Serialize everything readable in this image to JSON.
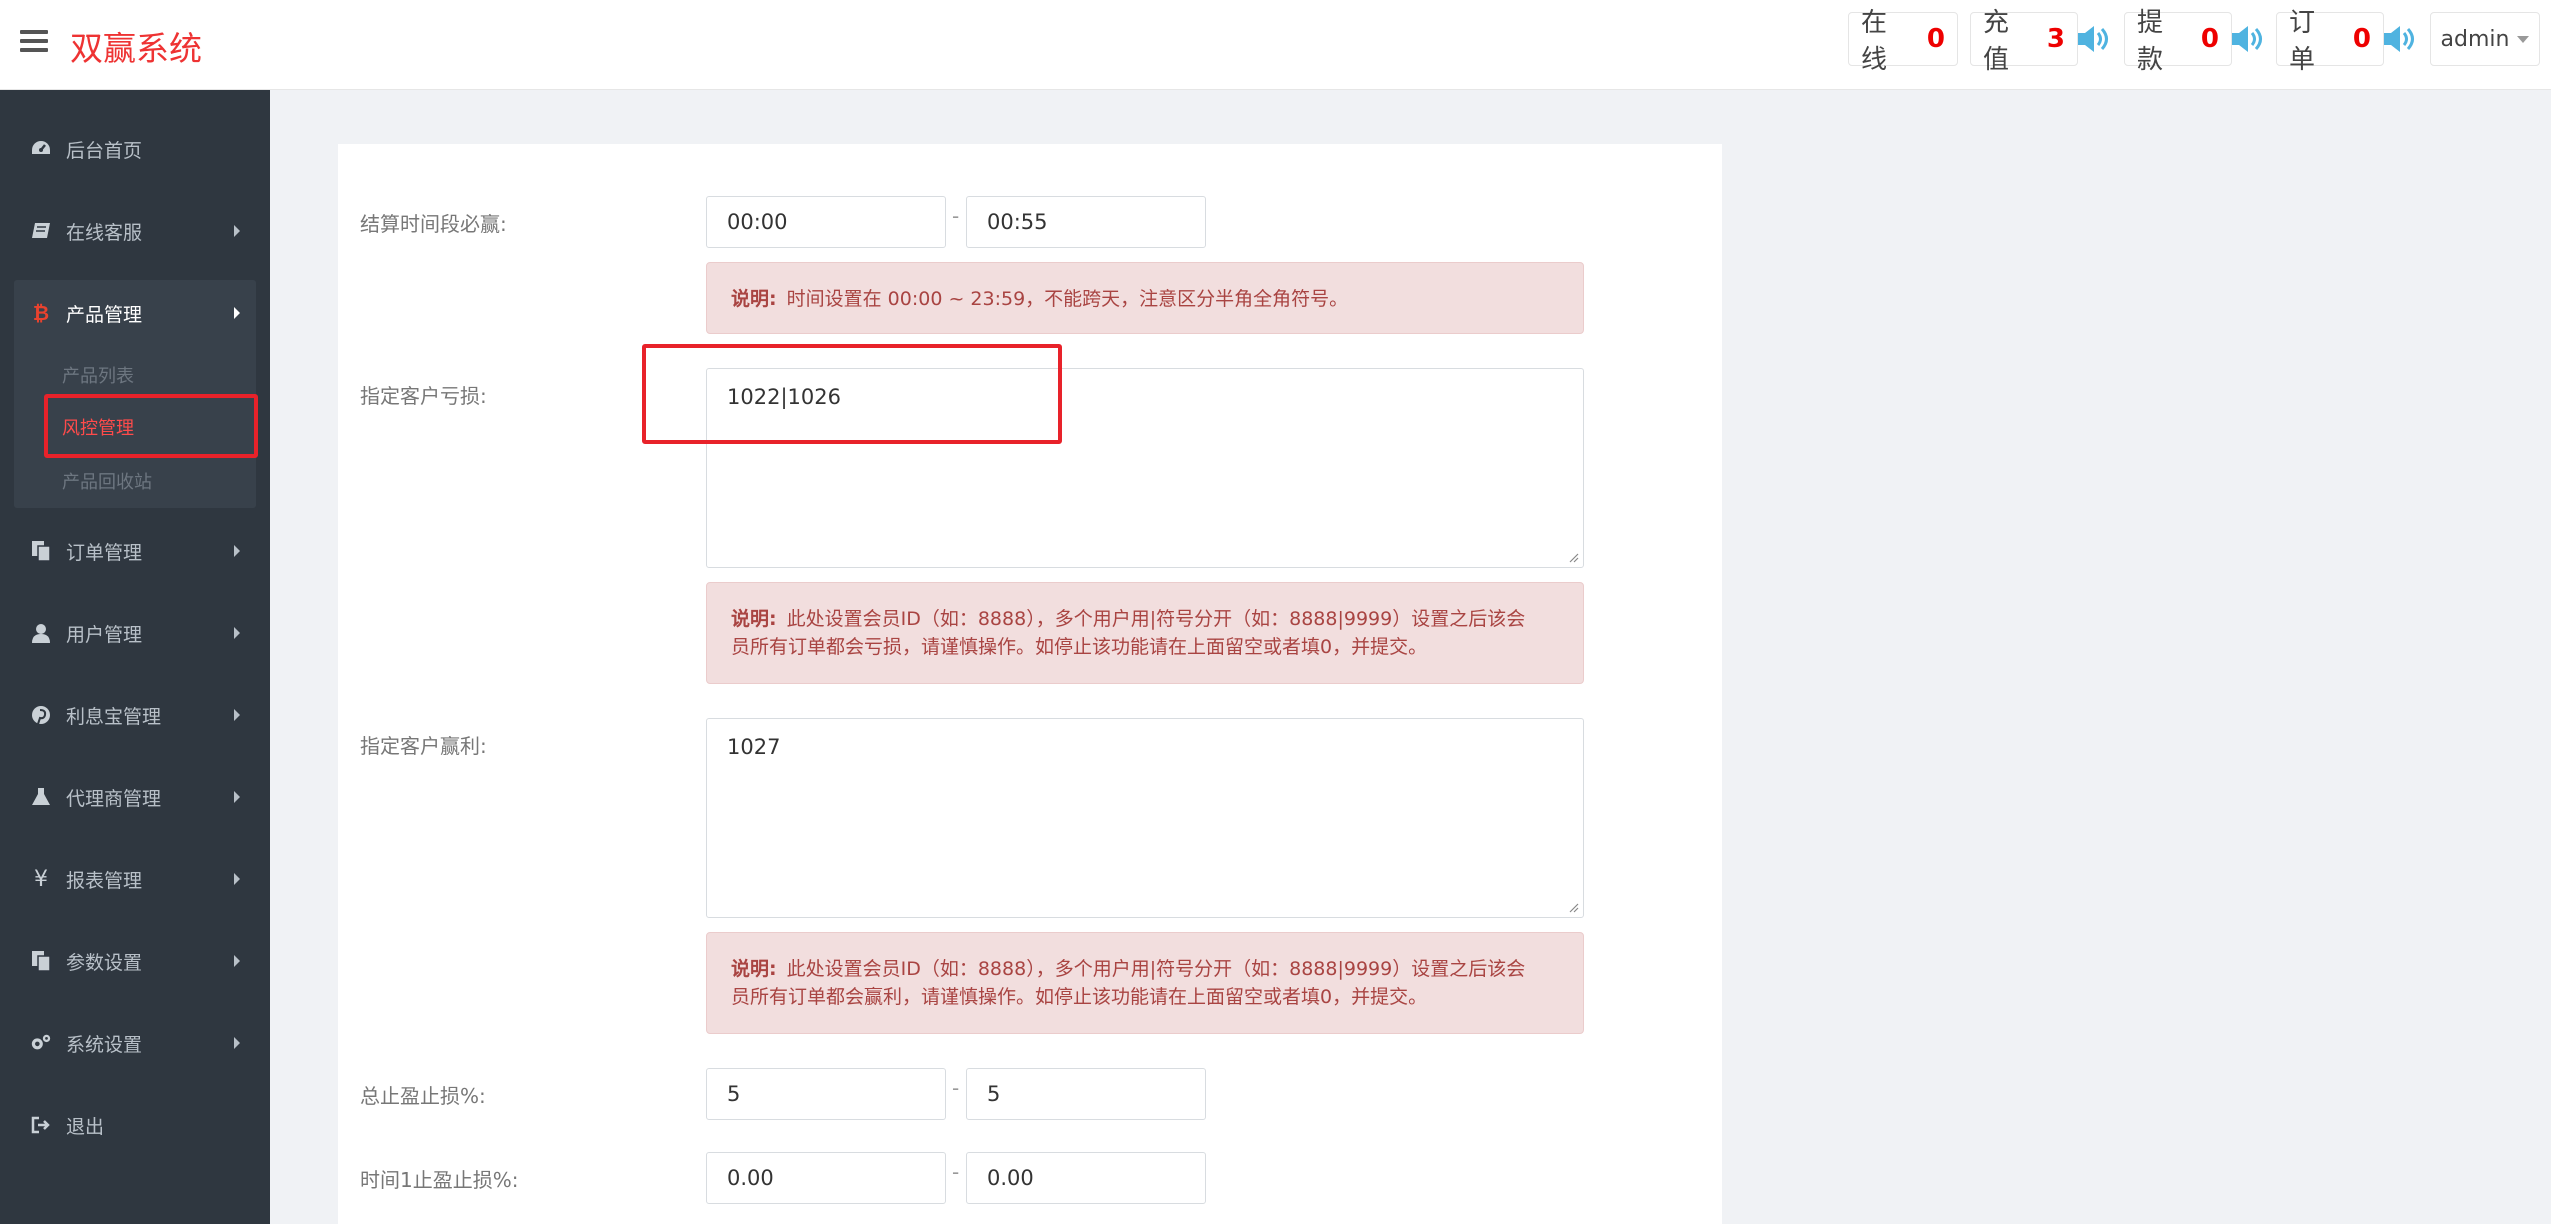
{
  "header": {
    "brand": "双赢系统",
    "stats": [
      {
        "label": "在线",
        "value": "0"
      },
      {
        "label": "充值",
        "value": "3"
      },
      {
        "label": "提款",
        "value": "0"
      },
      {
        "label": "订单",
        "value": "0"
      }
    ],
    "user": "admin",
    "speaker_color": "#4fb3e0"
  },
  "sidebar": {
    "items": [
      {
        "label": "后台首页",
        "icon": "dashboard-icon"
      },
      {
        "label": "在线客服",
        "icon": "book-icon"
      },
      {
        "label": "产品管理",
        "icon": "bitcoin-icon"
      },
      {
        "label": "订单管理",
        "icon": "copy-icon"
      },
      {
        "label": "用户管理",
        "icon": "user-icon"
      },
      {
        "label": "利息宝管理",
        "icon": "pinterest-icon"
      },
      {
        "label": "代理商管理",
        "icon": "flask-icon"
      },
      {
        "label": "报表管理",
        "icon": "yen-icon"
      },
      {
        "label": "参数设置",
        "icon": "copy-icon"
      },
      {
        "label": "系统设置",
        "icon": "gears-icon"
      },
      {
        "label": "退出",
        "icon": "sign-out-icon"
      }
    ],
    "sub_items": [
      "产品列表",
      "风控管理",
      "产品回收站"
    ]
  },
  "form": {
    "settle_label": "结算时间段必赢:",
    "settle_start": "00:00",
    "settle_end": "00:55",
    "settle_note_title": "说明:",
    "settle_note": "时间设置在 00:00 ~ 23:59，不能跨天，注意区分半角全角符号。",
    "loss_label": "指定客户亏损:",
    "loss_value": "1022|1026",
    "loss_note_title": "说明:",
    "loss_note_line1": "此处设置会员ID（如：8888），多个用户用|符号分开（如：8888|9999）设置之后该会",
    "loss_note_line2": "员所有订单都会亏损，请谨慎操作。如停止该功能请在上面留空或者填0，并提交。",
    "win_label": "指定客户赢利:",
    "win_value": "1027",
    "win_note_title": "说明:",
    "win_note_line1": "此处设置会员ID（如：8888），多个用户用|符号分开（如：8888|9999）设置之后该会",
    "win_note_line2": "员所有订单都会赢利，请谨慎操作。如停止该功能请在上面留空或者填0，并提交。",
    "stop_label": "总止盈止损%:",
    "stop_min": "5",
    "stop_max": "5",
    "time_stop_label": "时间1止盈止损%:",
    "time_stop_min": "0.00",
    "time_stop_max": "0.00",
    "dash": "-"
  }
}
